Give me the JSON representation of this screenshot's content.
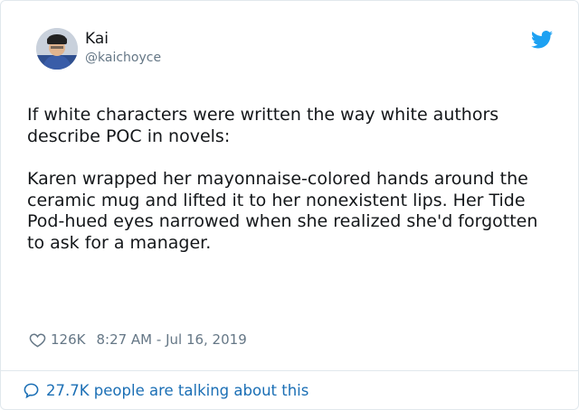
{
  "author": {
    "name": "Kai",
    "handle": "@kaichoyce"
  },
  "tweet": {
    "paragraphs": [
      "If white characters were written the way white authors describe POC in novels:",
      "Karen wrapped her mayonnaise-colored hands around the ceramic mug and lifted it to her nonexistent lips. Her Tide Pod-hued eyes narrowed when she realized she'd forgotten to ask for a manager."
    ],
    "likes": "126K",
    "timestamp": "8:27 AM - Jul 16, 2019"
  },
  "footer": {
    "talking_label": "27.7K people are talking about this"
  },
  "icons": {
    "brand": "twitter-bird-icon",
    "like": "heart-icon",
    "reply": "speech-bubble-icon"
  },
  "colors": {
    "brand_blue": "#1da1f2",
    "link_blue": "#1b6fb5",
    "muted_gray": "#657786",
    "text": "#14171a",
    "border": "#e1e8ed"
  }
}
